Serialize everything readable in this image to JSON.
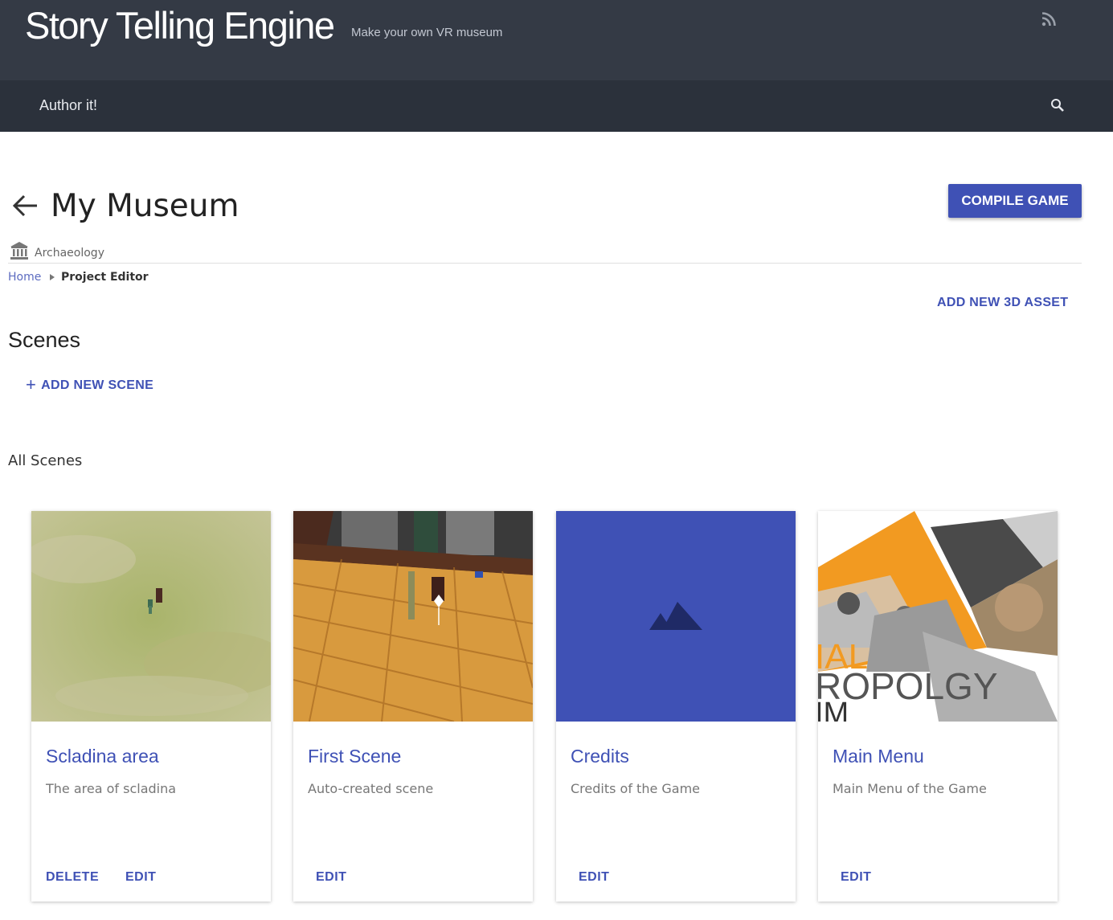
{
  "site": {
    "title": "Story Telling Engine",
    "tagline": "Make your own VR museum",
    "rss_icon": "rss-icon"
  },
  "nav": {
    "author_label": "Author it!",
    "search_icon": "search-icon"
  },
  "project": {
    "title": "My Museum",
    "category": "Archaeology",
    "compile_label": "COMPILE GAME"
  },
  "breadcrumb": {
    "home": "Home",
    "current": "Project Editor"
  },
  "actions": {
    "add_asset": "ADD NEW 3D ASSET",
    "add_scene_plus": "+",
    "add_scene": "ADD NEW SCENE"
  },
  "sections": {
    "scenes_heading": "Scenes",
    "all_scenes": "All Scenes"
  },
  "scenes": [
    {
      "title": "Scladina area",
      "description": "The area of scladina",
      "delete_label": "DELETE",
      "edit_label": "EDIT"
    },
    {
      "title": "First Scene",
      "description": "Auto-created scene",
      "edit_label": "EDIT"
    },
    {
      "title": "Credits",
      "description": "Credits of the Game",
      "edit_label": "EDIT"
    },
    {
      "title": "Main Menu",
      "description": "Main Menu of the Game",
      "edit_label": "EDIT"
    }
  ],
  "poster_text": {
    "line1": "IAL",
    "line2": "ROPOLGY",
    "line3": "IM"
  },
  "colors": {
    "header_bg": "#343a45",
    "nav_bg": "#2b313b",
    "accent": "#3f51b5"
  }
}
